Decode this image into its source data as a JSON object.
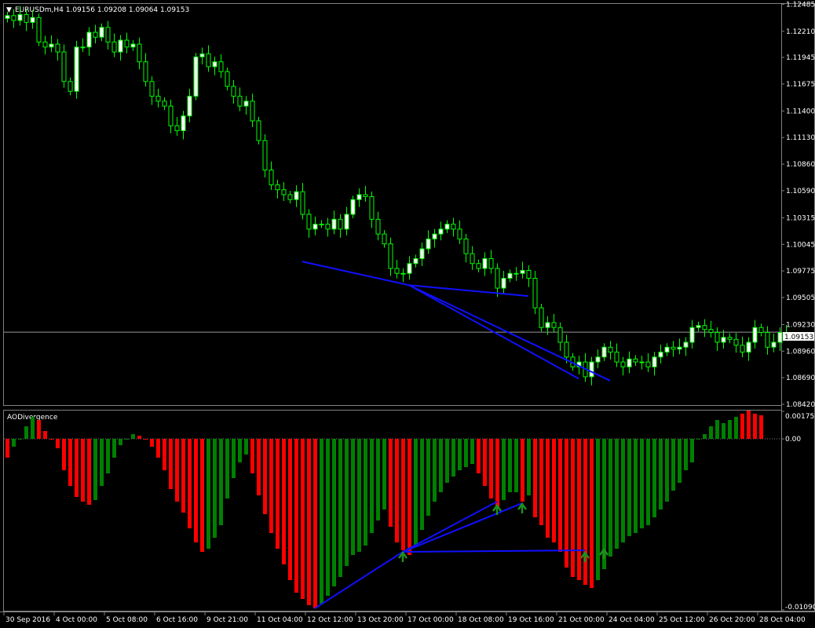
{
  "window": {
    "symbol_header": "EURUSDm,H4  1.09156 1.09208 1.09064 1.09153",
    "indicator_name": "AODivergence",
    "current_price_label": "1.09153"
  },
  "colors": {
    "background": "#000000",
    "grid": "#808080",
    "bull_candle_body": "#ffffff",
    "candle_outline": "#00ff00",
    "bear_candle_body": "#000000",
    "ao_up": "#008000",
    "ao_down": "#ff0000",
    "divergence_line": "#1010ff",
    "arrow": "#1f8f1f",
    "text": "#ffffff"
  },
  "chart_data": [
    {
      "type": "candlestick",
      "name": "EURUSDm,H4",
      "ylim": [
        1.0842,
        1.1248
      ],
      "yticks": [
        "1.12485",
        "1.12210",
        "1.11945",
        "1.11675",
        "1.11400",
        "1.11130",
        "1.10860",
        "1.10590",
        "1.10315",
        "1.10045",
        "1.09775",
        "1.09505",
        "1.09230",
        "1.08960",
        "1.08690",
        "1.08420"
      ],
      "current_price": 1.09153,
      "close": [
        1.1237,
        1.1232,
        1.1238,
        1.123,
        1.1235,
        1.121,
        1.1205,
        1.1208,
        1.12,
        1.117,
        1.116,
        1.1205,
        1.1205,
        1.122,
        1.1215,
        1.1225,
        1.121,
        1.12,
        1.1212,
        1.1205,
        1.1208,
        1.119,
        1.117,
        1.1155,
        1.115,
        1.1145,
        1.1125,
        1.112,
        1.1135,
        1.1155,
        1.1195,
        1.1198,
        1.1185,
        1.119,
        1.118,
        1.1165,
        1.1155,
        1.1145,
        1.115,
        1.113,
        1.111,
        1.108,
        1.1065,
        1.106,
        1.1055,
        1.105,
        1.1058,
        1.1035,
        1.102,
        1.1025,
        1.1025,
        1.102,
        1.103,
        1.102,
        1.1035,
        1.105,
        1.1055,
        1.1053,
        1.103,
        1.1015,
        1.1005,
        1.098,
        1.0975,
        1.0975,
        1.0985,
        1.099,
        1.1,
        1.101,
        1.1015,
        1.102,
        1.1025,
        1.102,
        1.101,
        1.0995,
        1.0985,
        1.098,
        1.099,
        1.098,
        1.096,
        1.097,
        1.0975,
        1.0975,
        1.0978,
        1.097,
        1.094,
        1.092,
        1.0925,
        1.092,
        1.0905,
        1.089,
        1.088,
        1.0885,
        1.087,
        1.0885,
        1.089,
        1.09,
        1.0895,
        1.0885,
        1.088,
        1.0888,
        1.0885,
        1.0885,
        1.088,
        1.089,
        1.0895,
        1.09,
        1.0898,
        1.09,
        1.0905,
        1.092,
        1.0922,
        1.0918,
        1.0915,
        1.0905,
        1.091,
        1.0908,
        1.0902,
        1.0895,
        1.0905,
        1.092,
        1.0915,
        1.09,
        1.0905,
        1.0915,
        1.0915
      ],
      "xtick_labels": [
        "30 Sep 2016",
        "4 Oct 00:00",
        "5 Oct 08:00",
        "6 Oct 16:00",
        "9 Oct 21:00",
        "11 Oct 04:00",
        "12 Oct 12:00",
        "13 Oct 20:00",
        "17 Oct 00:00",
        "18 Oct 08:00",
        "19 Oct 16:00",
        "21 Oct 00:00",
        "24 Oct 04:00",
        "25 Oct 12:00",
        "26 Oct 20:00",
        "28 Oct 04:00"
      ],
      "divergence_lines": [
        {
          "from": [
            47,
            1.0987
          ],
          "to": [
            64,
            1.0963
          ]
        },
        {
          "from": [
            64,
            1.0963
          ],
          "to": [
            83,
            1.0952
          ]
        },
        {
          "from": [
            64,
            1.0963
          ],
          "to": [
            91,
            1.0868
          ]
        },
        {
          "from": [
            64,
            1.0963
          ],
          "to": [
            96,
            1.0866
          ]
        }
      ]
    },
    {
      "type": "bar",
      "name": "AODivergence",
      "ylim": [
        -0.0109,
        0.001753
      ],
      "yticks": [
        "0.001753",
        "0.00",
        "-0.01090"
      ],
      "values": [
        -0.0012,
        -0.0005,
        0.0,
        0.0008,
        0.0014,
        0.0012,
        0.0005,
        0.0,
        -0.0006,
        -0.002,
        -0.003,
        -0.0037,
        -0.004,
        -0.0042,
        -0.0039,
        -0.003,
        -0.0022,
        -0.0012,
        -0.0004,
        0.0,
        0.0003,
        0.0002,
        0.0,
        -0.0005,
        -0.0012,
        -0.002,
        -0.0032,
        -0.004,
        -0.0047,
        -0.0057,
        -0.0066,
        -0.0072,
        -0.007,
        -0.0063,
        -0.0055,
        -0.0038,
        -0.0025,
        -0.0015,
        -0.001,
        -0.0022,
        -0.0036,
        -0.0048,
        -0.006,
        -0.007,
        -0.008,
        -0.009,
        -0.0098,
        -0.0102,
        -0.0106,
        -0.0108,
        -0.0105,
        -0.01,
        -0.0094,
        -0.0088,
        -0.0081,
        -0.0074,
        -0.0072,
        -0.0068,
        -0.006,
        -0.0052,
        -0.0045,
        -0.0056,
        -0.0066,
        -0.0071,
        -0.0074,
        -0.0068,
        -0.0058,
        -0.0049,
        -0.004,
        -0.0034,
        -0.0028,
        -0.0024,
        -0.002,
        -0.0018,
        -0.0016,
        -0.0022,
        -0.003,
        -0.0038,
        -0.0044,
        -0.0039,
        -0.0034,
        -0.0034,
        -0.004,
        -0.0036,
        -0.005,
        -0.0055,
        -0.0063,
        -0.0066,
        -0.0072,
        -0.0082,
        -0.0088,
        -0.009,
        -0.0093,
        -0.0095,
        -0.009,
        -0.0083,
        -0.0075,
        -0.007,
        -0.0066,
        -0.0062,
        -0.006,
        -0.0057,
        -0.0055,
        -0.005,
        -0.0045,
        -0.004,
        -0.0033,
        -0.0028,
        -0.002,
        -0.0015,
        0.0,
        0.0003,
        0.0008,
        0.0012,
        0.001,
        0.0012,
        0.0014,
        0.0016,
        0.0018,
        0.0016,
        0.0015
      ],
      "colors": [
        "dn",
        "up",
        "up",
        "up",
        "up",
        "dn",
        "dn",
        "dn",
        "dn",
        "dn",
        "dn",
        "dn",
        "dn",
        "dn",
        "up",
        "up",
        "up",
        "up",
        "up",
        "up",
        "up",
        "dn",
        "dn",
        "dn",
        "dn",
        "dn",
        "dn",
        "dn",
        "dn",
        "dn",
        "dn",
        "dn",
        "up",
        "up",
        "up",
        "up",
        "up",
        "up",
        "up",
        "dn",
        "dn",
        "dn",
        "dn",
        "dn",
        "dn",
        "dn",
        "dn",
        "dn",
        "dn",
        "dn",
        "up",
        "up",
        "up",
        "up",
        "up",
        "up",
        "up",
        "up",
        "up",
        "up",
        "up",
        "dn",
        "dn",
        "dn",
        "dn",
        "up",
        "up",
        "up",
        "up",
        "up",
        "up",
        "up",
        "up",
        "up",
        "up",
        "dn",
        "dn",
        "dn",
        "dn",
        "up",
        "up",
        "up",
        "dn",
        "up",
        "dn",
        "dn",
        "dn",
        "dn",
        "dn",
        "dn",
        "dn",
        "dn",
        "dn",
        "dn",
        "up",
        "up",
        "up",
        "up",
        "up",
        "up",
        "up",
        "up",
        "up",
        "up",
        "up",
        "up",
        "up",
        "up",
        "up",
        "up",
        "up",
        "up",
        "up",
        "up",
        "up",
        "up",
        "up",
        "dn",
        "dn",
        "dn",
        "dn",
        "dn",
        "dn",
        "dn"
      ],
      "divergence_lines": [
        {
          "from": [
            49,
            -0.0108
          ],
          "to": [
            63,
            -0.0072
          ]
        },
        {
          "from": [
            63,
            -0.0072
          ],
          "to": [
            78,
            -0.004
          ]
        },
        {
          "from": [
            63,
            -0.0072
          ],
          "to": [
            82,
            -0.0041
          ]
        },
        {
          "from": [
            63,
            -0.0072
          ],
          "to": [
            92,
            -0.0071
          ]
        }
      ],
      "arrows": [
        {
          "x": 63,
          "y": -0.0074
        },
        {
          "x": 78,
          "y": -0.0044
        },
        {
          "x": 82,
          "y": -0.0043
        },
        {
          "x": 92,
          "y": -0.0074
        },
        {
          "x": 95,
          "y": -0.0072
        }
      ]
    }
  ]
}
